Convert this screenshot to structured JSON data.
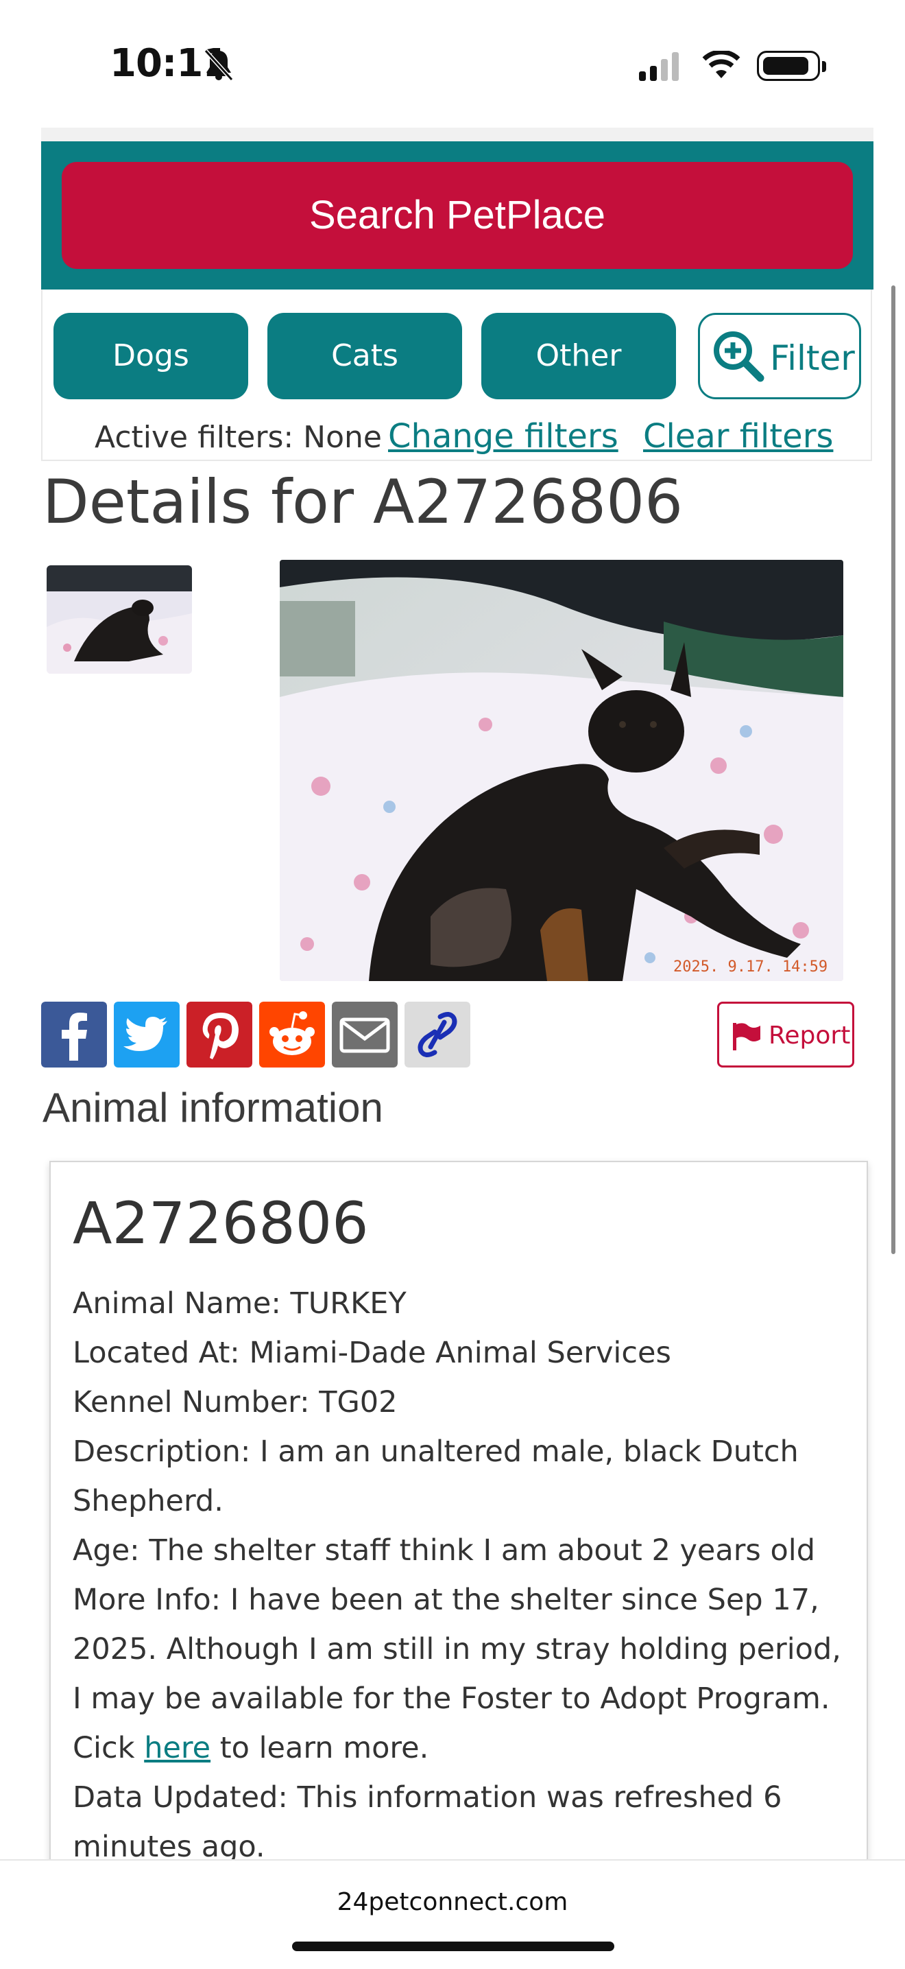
{
  "status_bar": {
    "time": "10:11"
  },
  "search": {
    "button_label": "Search PetPlace"
  },
  "filters": {
    "pills": [
      "Dogs",
      "Cats",
      "Other"
    ],
    "filter_label": "Filter",
    "active_text": "Active filters: None",
    "change_label": "Change filters",
    "clear_label": "Clear filters"
  },
  "page": {
    "title": "Details for A2726806"
  },
  "photo": {
    "timestamp": "2025. 9.17. 14:59"
  },
  "share": {
    "icons": [
      "facebook-icon",
      "twitter-icon",
      "pinterest-icon",
      "reddit-icon",
      "email-icon",
      "link-icon"
    ],
    "report_label": "Report"
  },
  "animal": {
    "section_title": "Animal information",
    "id": "A2726806",
    "name_line": "Animal Name: TURKEY",
    "located_line": "Located At: Miami-Dade Animal Services",
    "kennel_line": "Kennel Number: TG02",
    "description_line": "Description: I am an unaltered male, black Dutch Shepherd.",
    "age_line": "Age: The shelter staff think I am about 2 years old",
    "more_info_before": "More Info: I have been at the shelter since Sep 17, 2025. Although I am still in my stray holding period, I may be available for the Foster to Adopt Program. Cick ",
    "more_info_link": "here",
    "more_info_after": " to learn more.",
    "updated_line": "Data Updated: This information was refreshed 6 minutes ago."
  },
  "browser": {
    "url": "24petconnect.com"
  },
  "colors": {
    "teal": "#0b7d82",
    "crimson": "#c40f3b"
  }
}
